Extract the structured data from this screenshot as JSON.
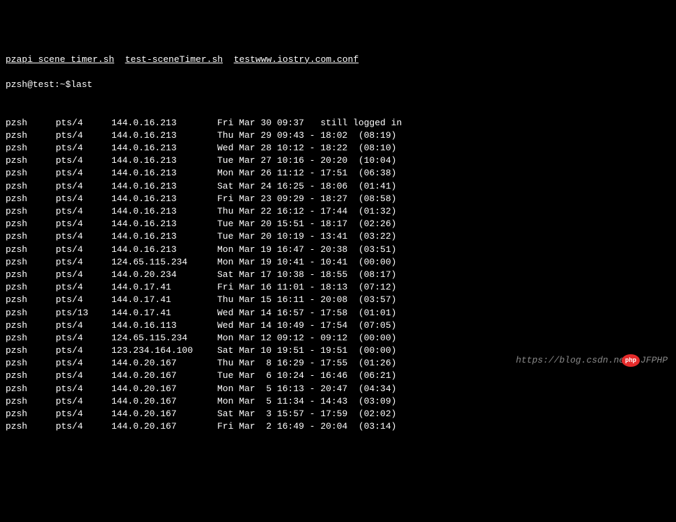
{
  "top_files": {
    "f1": "pzapi_scene_timer.sh",
    "f2": "test-sceneTimer.sh",
    "f3": "testwww.iostry.com.conf"
  },
  "prompt": {
    "userhost": "pzsh@test:~$",
    "command": "last"
  },
  "rows": [
    {
      "user": "pzsh",
      "tty": "pts/4",
      "ip": "144.0.16.213",
      "time": "Fri Mar 30 09:37   still logged in"
    },
    {
      "user": "pzsh",
      "tty": "pts/4",
      "ip": "144.0.16.213",
      "time": "Thu Mar 29 09:43 - 18:02  (08:19)"
    },
    {
      "user": "pzsh",
      "tty": "pts/4",
      "ip": "144.0.16.213",
      "time": "Wed Mar 28 10:12 - 18:22  (08:10)"
    },
    {
      "user": "pzsh",
      "tty": "pts/4",
      "ip": "144.0.16.213",
      "time": "Tue Mar 27 10:16 - 20:20  (10:04)"
    },
    {
      "user": "pzsh",
      "tty": "pts/4",
      "ip": "144.0.16.213",
      "time": "Mon Mar 26 11:12 - 17:51  (06:38)"
    },
    {
      "user": "pzsh",
      "tty": "pts/4",
      "ip": "144.0.16.213",
      "time": "Sat Mar 24 16:25 - 18:06  (01:41)"
    },
    {
      "user": "pzsh",
      "tty": "pts/4",
      "ip": "144.0.16.213",
      "time": "Fri Mar 23 09:29 - 18:27  (08:58)"
    },
    {
      "user": "pzsh",
      "tty": "pts/4",
      "ip": "144.0.16.213",
      "time": "Thu Mar 22 16:12 - 17:44  (01:32)"
    },
    {
      "user": "pzsh",
      "tty": "pts/4",
      "ip": "144.0.16.213",
      "time": "Tue Mar 20 15:51 - 18:17  (02:26)"
    },
    {
      "user": "pzsh",
      "tty": "pts/4",
      "ip": "144.0.16.213",
      "time": "Tue Mar 20 10:19 - 13:41  (03:22)"
    },
    {
      "user": "pzsh",
      "tty": "pts/4",
      "ip": "144.0.16.213",
      "time": "Mon Mar 19 16:47 - 20:38  (03:51)"
    },
    {
      "user": "pzsh",
      "tty": "pts/4",
      "ip": "124.65.115.234",
      "time": "Mon Mar 19 10:41 - 10:41  (00:00)"
    },
    {
      "user": "pzsh",
      "tty": "pts/4",
      "ip": "144.0.20.234",
      "time": "Sat Mar 17 10:38 - 18:55  (08:17)"
    },
    {
      "user": "pzsh",
      "tty": "pts/4",
      "ip": "144.0.17.41",
      "time": "Fri Mar 16 11:01 - 18:13  (07:12)"
    },
    {
      "user": "pzsh",
      "tty": "pts/4",
      "ip": "144.0.17.41",
      "time": "Thu Mar 15 16:11 - 20:08  (03:57)"
    },
    {
      "user": "pzsh",
      "tty": "pts/13",
      "ip": "144.0.17.41",
      "time": "Wed Mar 14 16:57 - 17:58  (01:01)"
    },
    {
      "user": "pzsh",
      "tty": "pts/4",
      "ip": "144.0.16.113",
      "time": "Wed Mar 14 10:49 - 17:54  (07:05)"
    },
    {
      "user": "pzsh",
      "tty": "pts/4",
      "ip": "124.65.115.234",
      "time": "Mon Mar 12 09:12 - 09:12  (00:00)"
    },
    {
      "user": "pzsh",
      "tty": "pts/4",
      "ip": "123.234.164.100",
      "time": "Sat Mar 10 19:51 - 19:51  (00:00)"
    },
    {
      "user": "pzsh",
      "tty": "pts/4",
      "ip": "144.0.20.167",
      "time": "Thu Mar  8 16:29 - 17:55  (01:26)"
    },
    {
      "user": "pzsh",
      "tty": "pts/4",
      "ip": "144.0.20.167",
      "time": "Tue Mar  6 10:24 - 16:46  (06:21)"
    },
    {
      "user": "pzsh",
      "tty": "pts/4",
      "ip": "144.0.20.167",
      "time": "Mon Mar  5 16:13 - 20:47  (04:34)"
    },
    {
      "user": "pzsh",
      "tty": "pts/4",
      "ip": "144.0.20.167",
      "time": "Mon Mar  5 11:34 - 14:43  (03:09)"
    },
    {
      "user": "pzsh",
      "tty": "pts/4",
      "ip": "144.0.20.167",
      "time": "Sat Mar  3 15:57 - 17:59  (02:02)"
    },
    {
      "user": "pzsh",
      "tty": "pts/4",
      "ip": "144.0.20.167",
      "time": "Fri Mar  2 16:49 - 20:04  (03:14)"
    }
  ],
  "watermark": {
    "prefix": "https://blog.csdn.ne",
    "badge": "php",
    "suffix": "JFPHP"
  }
}
